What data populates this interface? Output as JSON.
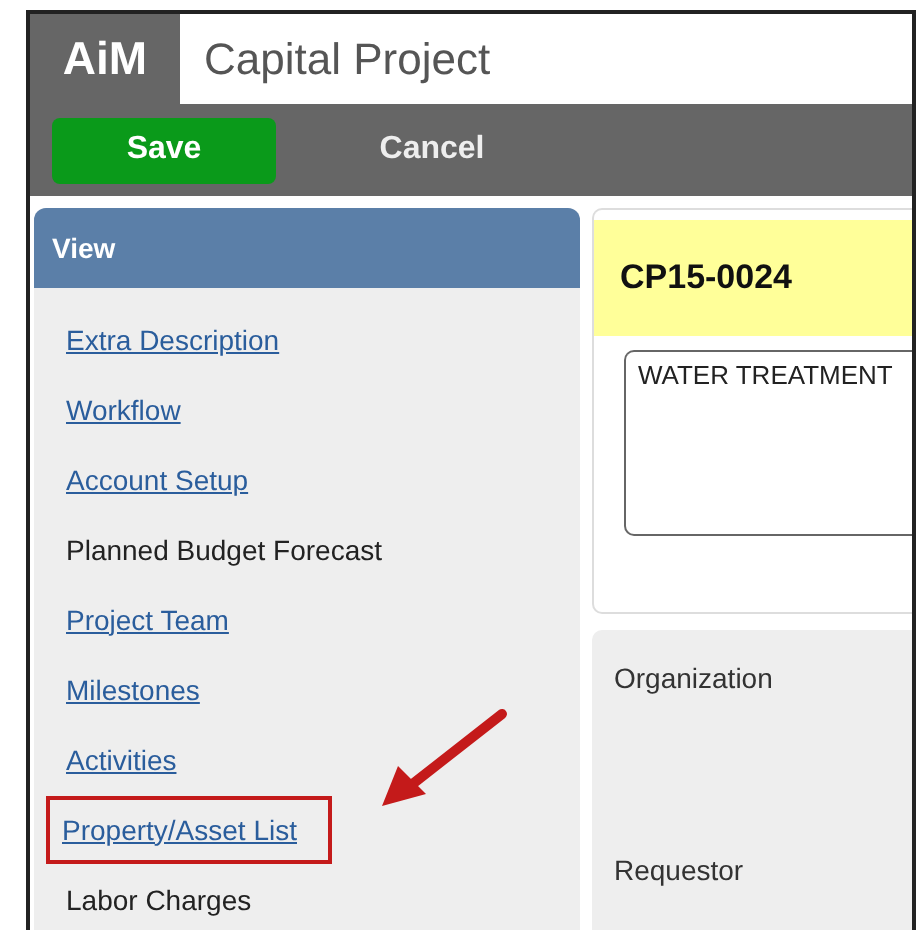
{
  "header": {
    "logo": "AiM",
    "title": "Capital Project"
  },
  "toolbar": {
    "buttons": [
      {
        "label": "Save",
        "kind": "primary"
      },
      {
        "label": "Cancel",
        "kind": "plain"
      }
    ]
  },
  "sidebar": {
    "title": "View",
    "items": [
      {
        "label": "Extra Description",
        "link": true,
        "highlighted": false
      },
      {
        "label": "Workflow",
        "link": true,
        "highlighted": false
      },
      {
        "label": "Account Setup",
        "link": true,
        "highlighted": false
      },
      {
        "label": "Planned Budget Forecast",
        "link": false,
        "highlighted": false
      },
      {
        "label": "Project Team",
        "link": true,
        "highlighted": false
      },
      {
        "label": "Milestones",
        "link": true,
        "highlighted": false
      },
      {
        "label": "Activities",
        "link": true,
        "highlighted": false
      },
      {
        "label": "Property/Asset List",
        "link": true,
        "highlighted": true
      },
      {
        "label": "Labor Charges",
        "link": false,
        "highlighted": false
      }
    ]
  },
  "record": {
    "id": "CP15-0024",
    "description": "WATER TREATMENT"
  },
  "fields": [
    {
      "label": "Organization"
    },
    {
      "label": "Requestor"
    }
  ]
}
